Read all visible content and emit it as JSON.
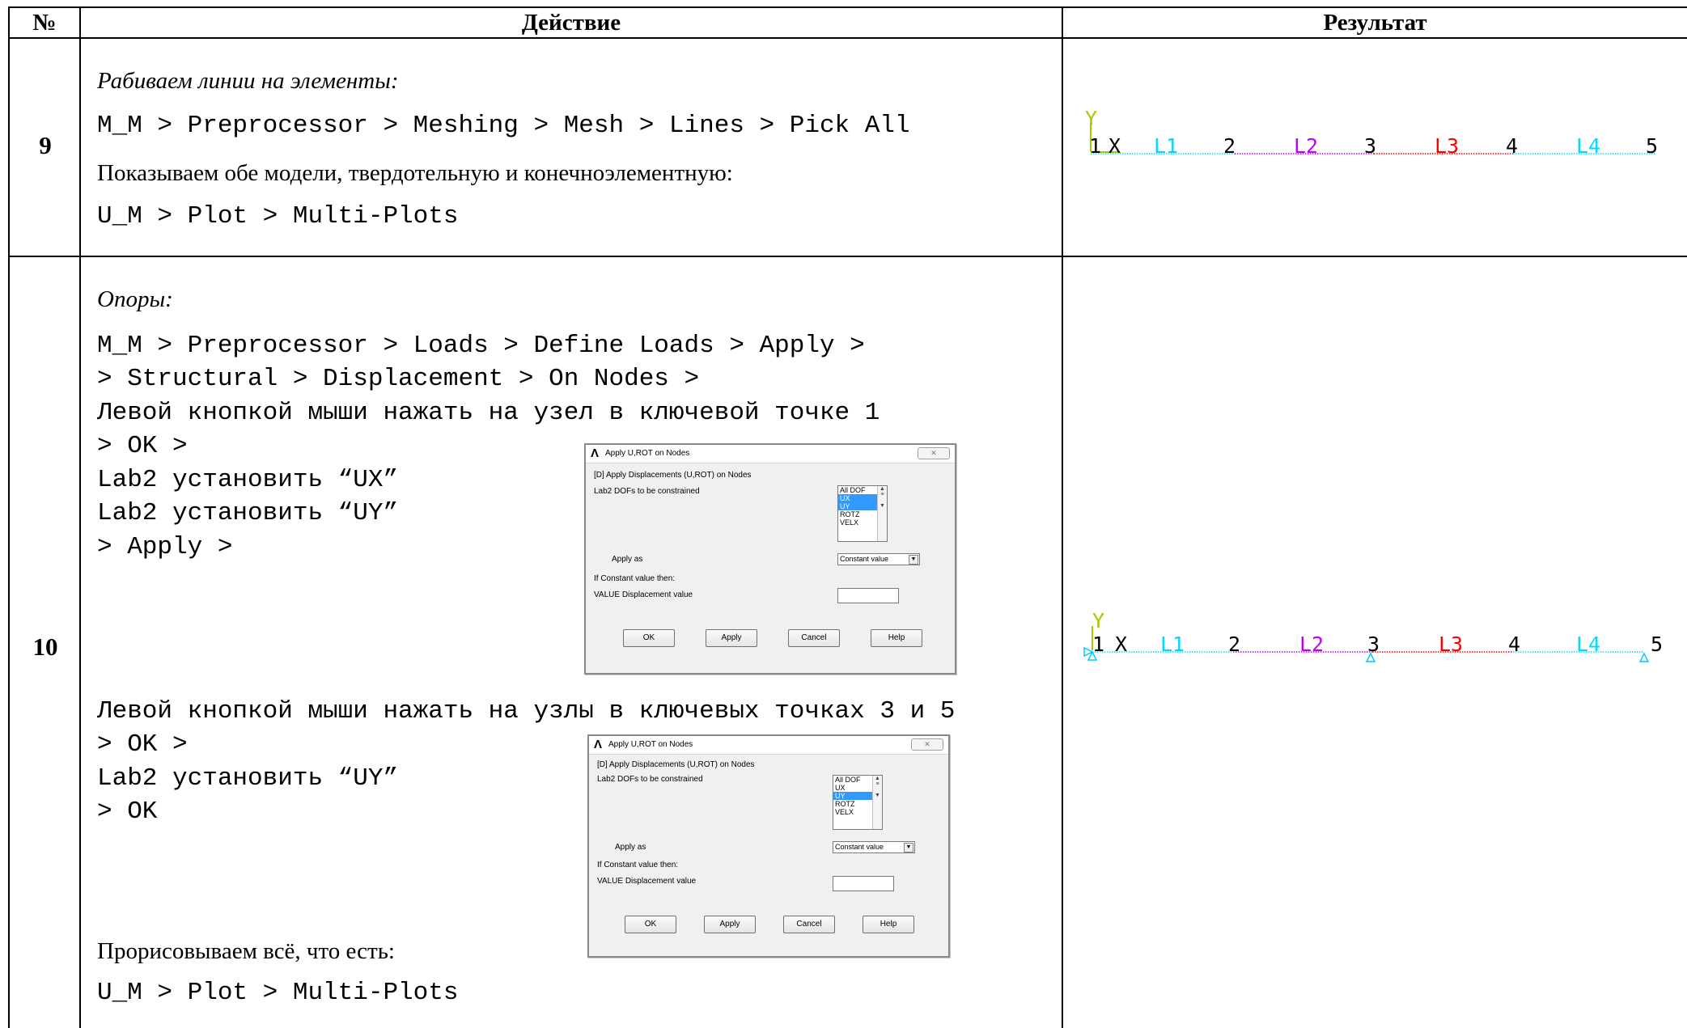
{
  "table": {
    "headers": {
      "number": "№",
      "action": "Действие",
      "result": "Результат"
    }
  },
  "rows": [
    {
      "number": "9",
      "lines": [
        "Рабиваем линии на элементы:",
        "M_M > Preprocessor > Meshing > Mesh > Lines > Pick All",
        "Показываем обе модели, твердотельную и конечноэлементную:",
        "U_M > Plot > Multi-Plots"
      ]
    },
    {
      "number": "10",
      "lines": [
        "Опоры:",
        "M_M > Preprocessor > Loads > Define Loads > Apply >",
        "> Structural > Displacement > On Nodes >",
        "Левой кнопкой мыши нажать на узел в ключевой точке 1",
        "> OK >",
        "Lab2 установить “UX”",
        "Lab2 установить “UY”",
        "> Apply >",
        "Левой кнопкой мыши нажать на узлы в ключевых точках 3 и 5",
        "> OK >",
        "Lab2 установить “UY”",
        "> OK",
        "Прорисовываем всё, что есть:",
        "U_M > Plot > Multi-Plots"
      ]
    }
  ],
  "dialogs": [
    {
      "title": "Apply U,ROT on Nodes",
      "heading": "[D]  Apply Displacements (U,ROT) on Nodes",
      "lab2_label": "Lab2   DOFs to be constrained",
      "options": [
        "All DOF",
        "UX",
        "UY",
        "ROTZ",
        "VELX"
      ],
      "selected": [
        "UX",
        "UY"
      ],
      "apply_as_label": "Apply as",
      "apply_as_value": "Constant value",
      "if_constant": "If Constant value then:",
      "value_label": "VALUE   Displacement value",
      "buttons": [
        "OK",
        "Apply",
        "Cancel",
        "Help"
      ]
    },
    {
      "title": "Apply U,ROT on Nodes",
      "heading": "[D]  Apply Displacements (U,ROT) on Nodes",
      "lab2_label": "Lab2   DOFs to be constrained",
      "options": [
        "All DOF",
        "UX",
        "UY",
        "ROTZ",
        "VELX"
      ],
      "selected": [
        "UY"
      ],
      "apply_as_label": "Apply as",
      "apply_as_value": "Constant value",
      "if_constant": "If Constant value then:",
      "value_label": "VALUE   Displacement value",
      "buttons": [
        "OK",
        "Apply",
        "Cancel",
        "Help"
      ]
    }
  ],
  "plots": {
    "axis_labels": {
      "y": "Y",
      "x": "X"
    },
    "keypoints": [
      "1",
      "2",
      "3",
      "4",
      "5"
    ],
    "lines": [
      "L1",
      "L2",
      "L3",
      "L4"
    ],
    "colors": {
      "L1": "#00d8ff",
      "L2": "#c000ff",
      "L3": "#ff0000",
      "L4": "#00d8ff",
      "axis_y": "#a8c800",
      "support": "#00c8ff",
      "keypoint": "#000000"
    },
    "row10_supports": [
      "1",
      "3",
      "5"
    ]
  }
}
